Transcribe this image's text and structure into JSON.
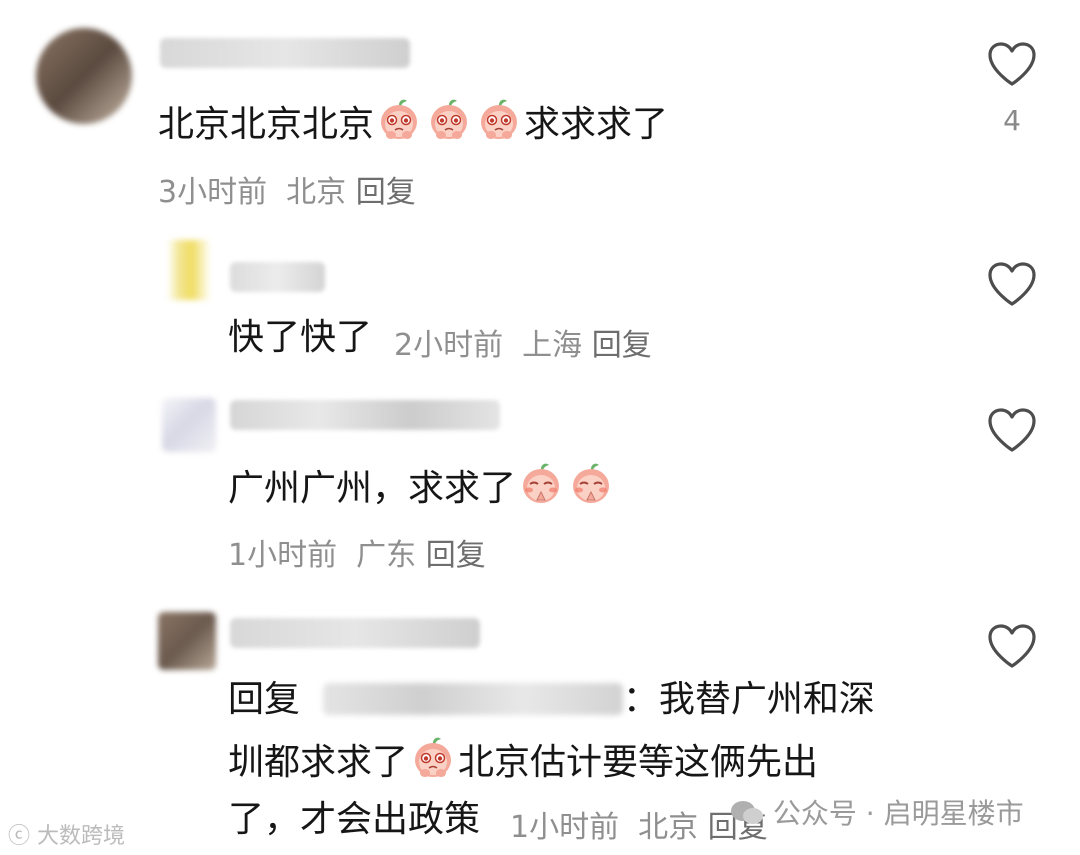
{
  "comments": [
    {
      "text_before": "北京北京北京",
      "emoji_count": 3,
      "text_after": "求求求了",
      "time": "3小时前",
      "location": "北京",
      "reply_label": "回复",
      "like_count": "4"
    },
    {
      "text": "快了快了",
      "time": "2小时前",
      "location": "上海",
      "reply_label": "回复"
    },
    {
      "text": "广州广州，求求了",
      "emoji_count": 2,
      "time": "1小时前",
      "location": "广东",
      "reply_label": "回复"
    },
    {
      "reply_prefix": "回复",
      "colon": "：",
      "line1": "我替广州和深",
      "line2_before": "圳都求求了",
      "line2_after": "北京估计要等这俩先出",
      "line3": "了，才会出政策",
      "time": "1小时前",
      "location": "北京",
      "reply_label": "回复"
    }
  ],
  "watermarks": {
    "left": "大数跨境",
    "right": "公众号 · 启明星楼市"
  },
  "icons": {
    "like": "heart-outline-icon",
    "emoji_plead": "pleading-peach-emoji",
    "emoji_pray": "praying-peach-emoji",
    "wechat": "wechat-icon"
  },
  "colors": {
    "text": "#161616",
    "meta": "#8f8f8f",
    "icon": "#555555",
    "emoji": "#f2a293"
  }
}
